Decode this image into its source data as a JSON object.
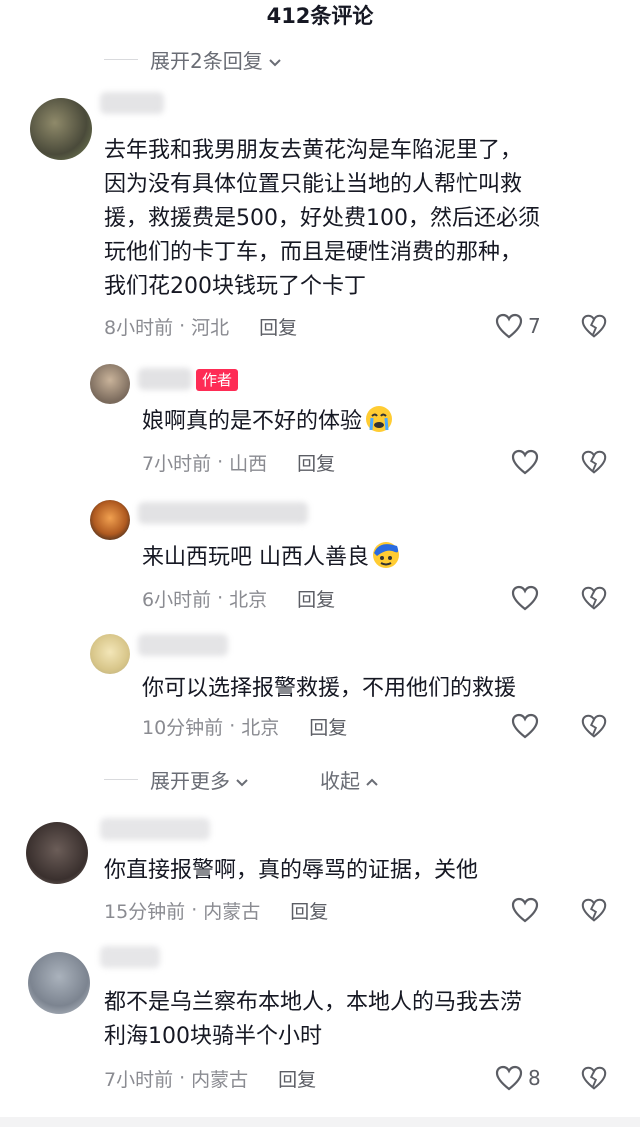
{
  "header": {
    "title": "412条评论"
  },
  "expand_top": {
    "label": "展开2条回复"
  },
  "comments": [
    {
      "lines": [
        "去年我和我男朋友去黄花沟是车陷泥里了，",
        "因为没有具体位置只能让当地的人帮忙叫救",
        "援，救援费是500，好处费100，然后还必须",
        "玩他们的卡丁车，而且是硬性消费的那种，",
        "我们花200块钱玩了个卡丁"
      ],
      "time": "8小时前",
      "location": "河北",
      "reply": "回复",
      "likes": "7"
    },
    {
      "badge": "作者",
      "text": "娘啊真的是不好的体验",
      "emoji": "crying-face-emoji",
      "time": "7小时前",
      "location": "山西",
      "reply": "回复",
      "likes": ""
    },
    {
      "text": "来山西玩吧  山西人善良",
      "emoji": "blue-face-emoji",
      "time": "6小时前",
      "location": "北京",
      "reply": "回复",
      "likes": ""
    },
    {
      "text": "你可以选择报警救援，不用他们的救援",
      "time": "10分钟前",
      "location": "北京",
      "reply": "回复",
      "likes": ""
    },
    {
      "text": "你直接报警啊，真的辱骂的证据，关他",
      "time": "15分钟前",
      "location": "内蒙古",
      "reply": "回复",
      "likes": ""
    },
    {
      "lines": [
        "都不是乌兰察布本地人，本地人的马我去涝",
        "利海100块骑半个小时"
      ],
      "time": "7小时前",
      "location": "内蒙古",
      "reply": "回复",
      "likes": "8"
    }
  ],
  "expand_more": {
    "label": "展开更多",
    "collapse": "收起"
  },
  "separator": "·",
  "colors": {
    "accent": "#fe2c55",
    "meta": "#8a8b91",
    "text": "#161823"
  }
}
